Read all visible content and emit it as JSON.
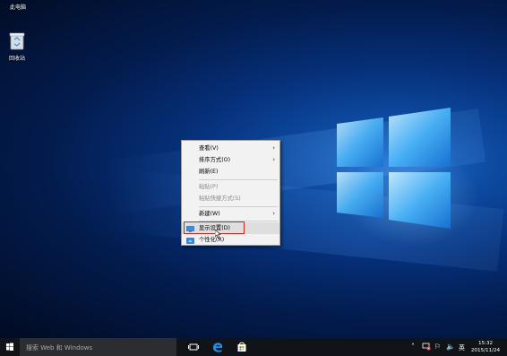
{
  "desktop": {
    "icons": [
      {
        "label": "此电脑"
      },
      {
        "label": "回收站"
      }
    ]
  },
  "context_menu": {
    "items": [
      {
        "label": "查看(V)",
        "submenu": true,
        "enabled": true
      },
      {
        "label": "排序方式(O)",
        "submenu": true,
        "enabled": true
      },
      {
        "label": "刷新(E)",
        "submenu": false,
        "enabled": true
      },
      {
        "label": "粘贴(P)",
        "submenu": false,
        "enabled": false
      },
      {
        "label": "粘贴快捷方式(S)",
        "submenu": false,
        "enabled": false
      },
      {
        "label": "新建(W)",
        "submenu": true,
        "enabled": true
      },
      {
        "label": "显示设置(D)",
        "submenu": false,
        "enabled": true,
        "highlighted": true
      },
      {
        "label": "个性化(R)",
        "submenu": false,
        "enabled": true
      }
    ],
    "highlight_color": "#e0201d"
  },
  "taskbar": {
    "search_placeholder": "搜索 Web 和 Windows",
    "tray": {
      "language": "英",
      "time": "15:32",
      "date": "2015/11/24"
    }
  },
  "colors": {
    "accent": "#1273d6",
    "taskbar": "#101418"
  }
}
